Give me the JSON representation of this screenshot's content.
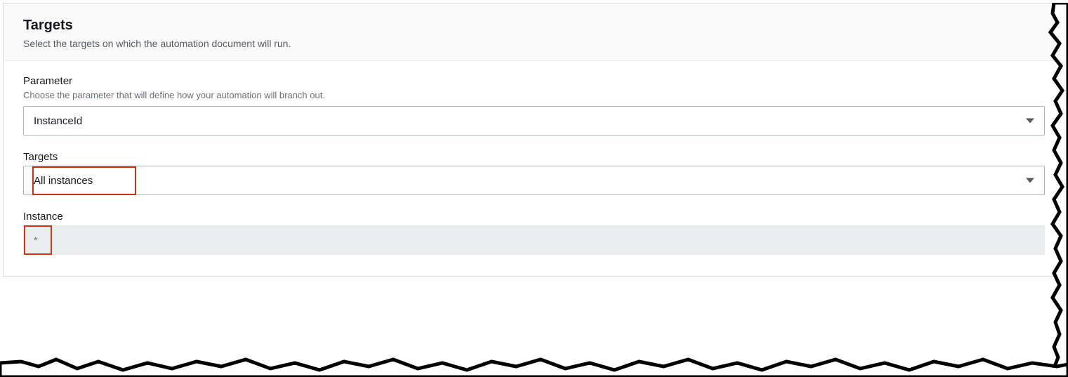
{
  "header": {
    "title": "Targets",
    "subtitle": "Select the targets on which the automation document will run."
  },
  "fields": {
    "parameter": {
      "label": "Parameter",
      "hint": "Choose the parameter that will define how your automation will branch out.",
      "selected": "InstanceId"
    },
    "targets": {
      "label": "Targets",
      "selected": "All instances"
    },
    "instance": {
      "label": "Instance",
      "value": "*"
    }
  }
}
